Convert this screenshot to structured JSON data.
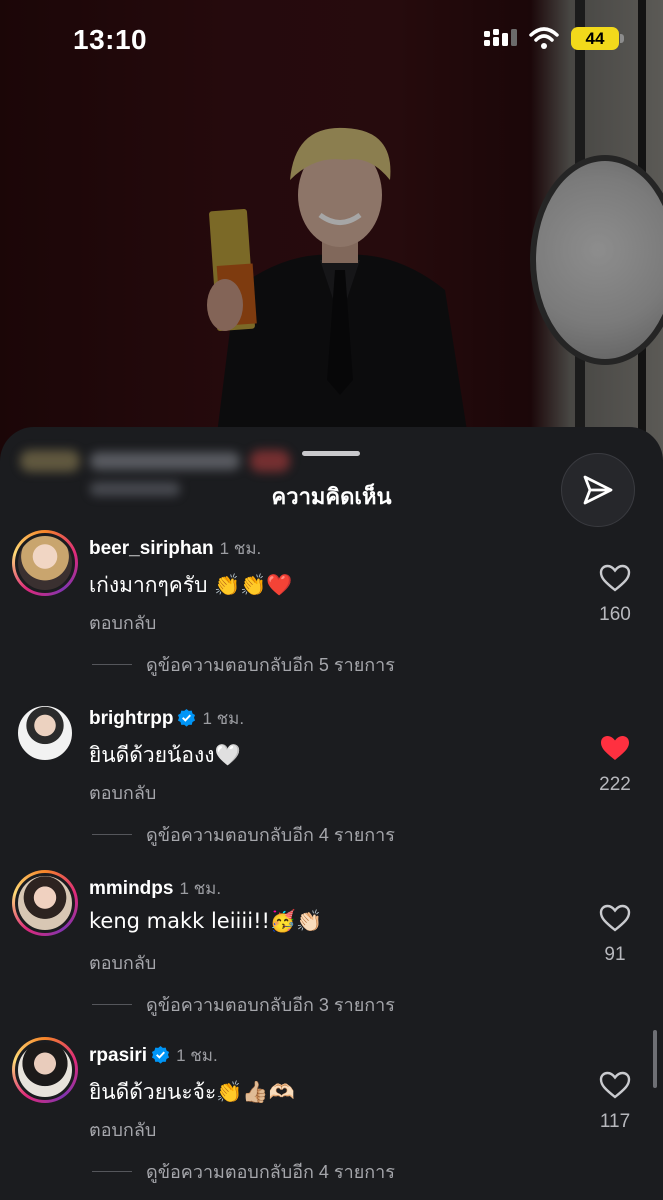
{
  "status_bar": {
    "time": "13:10",
    "battery": "44"
  },
  "sheet": {
    "title": "ความคิดเห็น"
  },
  "comments": [
    {
      "username": "beer_siriphan",
      "verified": false,
      "time": "1 ชม.",
      "text": "เก่งมากๆครับ 👏👏❤️",
      "reply_label": "ตอบกลับ",
      "likes": "160",
      "liked": false,
      "view_replies": "ดูข้อความตอบกลับอีก 5 รายการ"
    },
    {
      "username": "brightrpp",
      "verified": true,
      "time": "1 ชม.",
      "text": "ยินดีด้วยน้องง🤍",
      "reply_label": "ตอบกลับ",
      "likes": "222",
      "liked": true,
      "view_replies": "ดูข้อความตอบกลับอีก 4 รายการ"
    },
    {
      "username": "mmindps",
      "verified": false,
      "time": "1 ชม.",
      "text": "keng makk leiiii!!🥳👏🏻",
      "reply_label": "ตอบกลับ",
      "likes": "91",
      "liked": false,
      "view_replies": "ดูข้อความตอบกลับอีก 3 รายการ"
    },
    {
      "username": "rpasiri",
      "verified": true,
      "time": "1 ชม.",
      "text": "ยินดีด้วยนะจ้ะ👏👍🏼🫶🏻",
      "reply_label": "ตอบกลับ",
      "likes": "117",
      "liked": false,
      "view_replies": "ดูข้อความตอบกลับอีก 4 รายการ"
    }
  ],
  "colors": {
    "sheet_bg": "#1b1c1f",
    "liked_heart": "#ff3040",
    "verified_blue": "#0095f6",
    "battery_yellow": "#f2d91b"
  },
  "icons": {
    "share": "paper-plane-icon",
    "like": "heart-icon",
    "verified": "verified-badge-icon"
  }
}
